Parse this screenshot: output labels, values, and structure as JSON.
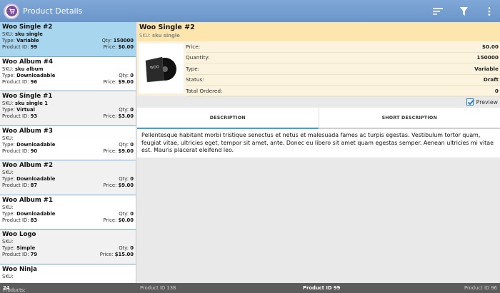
{
  "app": {
    "title": "Product Details",
    "actions": [
      {
        "name": "sort-icon"
      },
      {
        "name": "filter-icon"
      },
      {
        "name": "overflow-menu-icon"
      }
    ]
  },
  "products": [
    {
      "name": "Woo Single #2",
      "sku_label": "SKU:",
      "sku": "sku single",
      "type_label": "Type:",
      "type": "Variable",
      "qty_label": "Qty:",
      "qty": "150000",
      "id_label": "Product ID:",
      "id": "99",
      "price_label": "Price:",
      "price": "$0.00"
    },
    {
      "name": "Woo Album #4",
      "sku_label": "SKU:",
      "sku": "sku album",
      "type_label": "Type:",
      "type": "Downloadable",
      "qty_label": "Qty:",
      "qty": "0",
      "id_label": "Product ID:",
      "id": "96",
      "price_label": "Price:",
      "price": "$9.00"
    },
    {
      "name": "Woo Single #1",
      "sku_label": "SKU:",
      "sku": "sku single 1",
      "type_label": "Type:",
      "type": "Virtual",
      "qty_label": "Qty:",
      "qty": "0",
      "id_label": "Product ID:",
      "id": "93",
      "price_label": "Price:",
      "price": "$3.00"
    },
    {
      "name": "Woo Album #3",
      "sku_label": "SKU:",
      "sku": "",
      "type_label": "Type:",
      "type": "Downloadable",
      "qty_label": "Qty:",
      "qty": "0",
      "id_label": "Product ID:",
      "id": "90",
      "price_label": "Price:",
      "price": "$9.00"
    },
    {
      "name": "Woo Album #2",
      "sku_label": "SKU:",
      "sku": "",
      "type_label": "Type:",
      "type": "Downloadable",
      "qty_label": "Qty:",
      "qty": "0",
      "id_label": "Product ID:",
      "id": "87",
      "price_label": "Price:",
      "price": "$9.00"
    },
    {
      "name": "Woo Album #1",
      "sku_label": "SKU:",
      "sku": "",
      "type_label": "Type:",
      "type": "Downloadable",
      "qty_label": "Qty:",
      "qty": "0",
      "id_label": "Product ID:",
      "id": "83",
      "price_label": "Price:",
      "price": "$0.00"
    },
    {
      "name": "Woo Logo",
      "sku_label": "SKU:",
      "sku": "",
      "type_label": "Type:",
      "type": "Simple",
      "qty_label": "Qty:",
      "qty": "0",
      "id_label": "Product ID:",
      "id": "79",
      "price_label": "Price:",
      "price": "$15.00"
    },
    {
      "name": "Woo Ninja",
      "sku_label": "SKU:",
      "sku": "",
      "type_label": "",
      "type": "",
      "qty_label": "",
      "qty": "",
      "id_label": "",
      "id": "",
      "price_label": "",
      "price": ""
    }
  ],
  "detail": {
    "name": "Woo Single #2",
    "sku_label": "SKU:",
    "sku": "sku single",
    "album_art_text": "WOO",
    "props": [
      {
        "key": "Price:",
        "value": "$0.00"
      },
      {
        "key": "Quantity:",
        "value": "150000"
      },
      {
        "key": "Type:",
        "value": "Variable"
      },
      {
        "key": "Status:",
        "value": "Draft"
      },
      {
        "key": "Total Ordered:",
        "value": "0"
      }
    ],
    "preview_label": "Preview",
    "preview_checked": true,
    "tabs": [
      "DESCRIPTION",
      "SHORT DESCRIPTION"
    ],
    "description": "Pellentesque habitant morbi tristique senectus et netus et malesuada fames ac turpis egestas. Vestibulum tortor quam, feugiat vitae, ultricies eget, tempor sit amet, ante. Donec eu libero sit amet quam egestas semper. Aenean ultricies mi vitae est. Mauris placerat eleifend leo."
  },
  "statusbar": {
    "products_label": "Products:",
    "products_count": "24",
    "prev": "Product ID 138",
    "current": "Product ID 99",
    "next": "Product ID 96"
  },
  "colors": {
    "actionbar": "#7fa8d8",
    "selected": "#a9d6ef",
    "detail_header": "#fde6ad",
    "tab_indicator": "#3ba3e0"
  }
}
